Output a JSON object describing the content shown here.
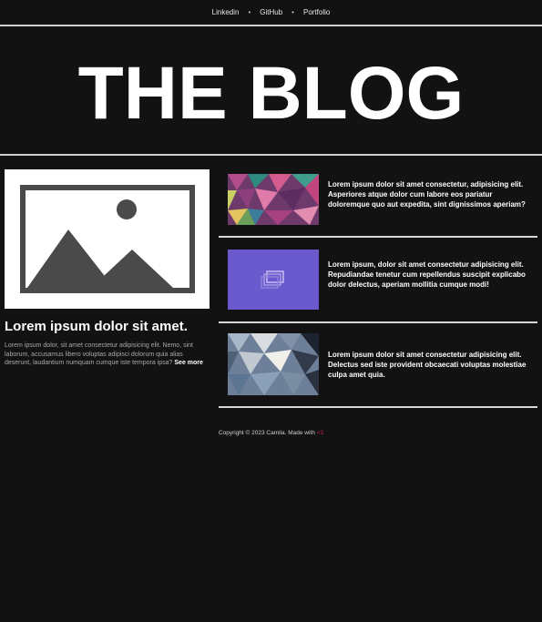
{
  "nav": {
    "links": [
      "Linkedin",
      "GitHub",
      "Portfolio"
    ],
    "separator": "•"
  },
  "hero": {
    "title": "THE BLOG"
  },
  "feature": {
    "title": "Lorem ipsum dolor sit amet.",
    "text": "Lorem ipsum dolor, sit amet consectetur adipisicing elit. Nemo, sint laborum, accusamus libero voluptas adipisci dolorum quia alias deserunt, laudantium numquam cumque iste tempora ipsa?",
    "more": "See more"
  },
  "posts": [
    {
      "text": "Lorem ipsum dolor sit amet consectetur, adipisicing elit. Asperiores atque dolor cum labore eos pariatur doloremque quo aut expedita, sint dignissimos aperiam?",
      "thumb": "pink-polygon-image"
    },
    {
      "text": "Lorem ipsum, dolor sit amet consectetur adipisicing elit. Repudiandae tenetur cum repellendus suscipit explicabo dolor delectus, aperiam mollitia cumque modi!",
      "thumb": "purple-gallery-image"
    },
    {
      "text": "Lorem ipsum dolor sit amet consectetur adipisicing elit. Delectus sed iste provident obcaecati voluptas molestiae culpa amet quia.",
      "thumb": "blue-grey-polygon-image"
    }
  ],
  "footer": {
    "text": "Copyright © 2023 Camila. Made with ",
    "heart": "<3"
  },
  "colors": {
    "background": "#121212",
    "accent_purple": "#6a5acd",
    "heart": "#c0204a"
  }
}
